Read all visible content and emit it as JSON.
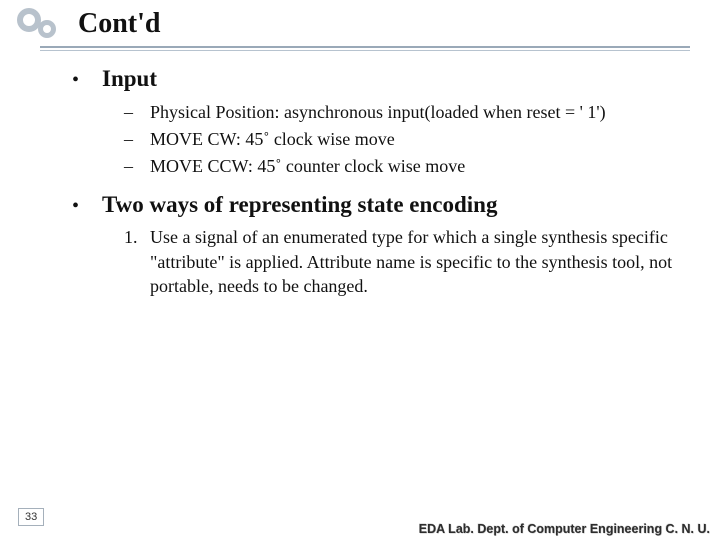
{
  "slide": {
    "title": "Cont'd",
    "bullets": [
      {
        "marker": "•",
        "text": "Input",
        "sub": [
          {
            "marker": "–",
            "text": "Physical Position: asynchronous input(loaded when reset = ' 1')"
          },
          {
            "marker": "–",
            "text": "MOVE CW: 45˚ clock wise move"
          },
          {
            "marker": "–",
            "text": "MOVE CCW: 45˚ counter clock wise move"
          }
        ]
      },
      {
        "marker": "•",
        "text": "Two ways of representing state encoding",
        "numbered": [
          {
            "marker": "1.",
            "text": "Use a signal of an enumerated type for which a single synthesis specific \"attribute\" is applied. Attribute name is specific to the synthesis tool, not portable, needs to be changed."
          }
        ]
      }
    ]
  },
  "footer": {
    "page": "33",
    "org": "EDA Lab. Dept. of Computer Engineering C. N. U."
  }
}
